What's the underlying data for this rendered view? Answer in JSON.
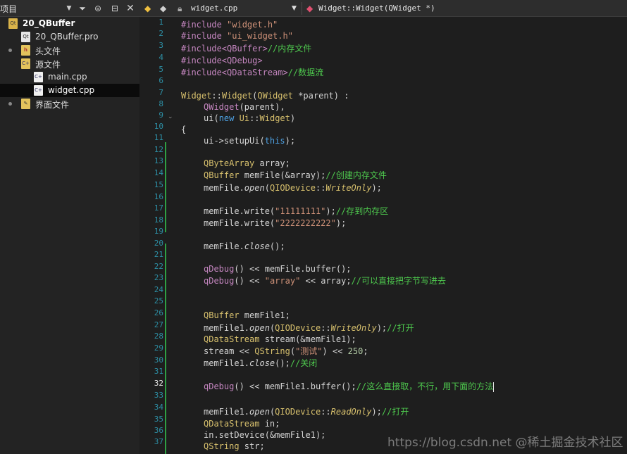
{
  "left_panel": {
    "title": "项目",
    "tree": [
      {
        "label": "20_QBuffer",
        "kind": "project",
        "bold": true
      },
      {
        "label": "20_QBuffer.pro",
        "kind": "pro"
      },
      {
        "label": "头文件",
        "kind": "folder-h"
      },
      {
        "label": "源文件",
        "kind": "folder-cpp"
      },
      {
        "label": "main.cpp",
        "kind": "cpp"
      },
      {
        "label": "widget.cpp",
        "kind": "cpp",
        "selected": true
      },
      {
        "label": "界面文件",
        "kind": "folder-ui"
      }
    ]
  },
  "editor": {
    "file_name": "widget.cpp",
    "symbol": "Widget::Widget(QWidget *)",
    "current_line": 32,
    "line_numbers": [
      1,
      2,
      3,
      4,
      5,
      6,
      7,
      8,
      9,
      10,
      11,
      12,
      13,
      14,
      15,
      16,
      17,
      18,
      19,
      20,
      21,
      22,
      23,
      24,
      25,
      26,
      27,
      28,
      29,
      30,
      31,
      32,
      33,
      34,
      35,
      36,
      37
    ]
  },
  "code_text": {
    "l1_a": "#include",
    "l1_b": "\"widget.h\"",
    "l2_a": "#include",
    "l2_b": "\"ui_widget.h\"",
    "l3_a": "#include<QBuffer>",
    "l3_b": "//内存文件",
    "l4_a": "#include<QDebug>",
    "l5_a": "#include<QDataStream>",
    "l5_b": "//数据流",
    "l7_a": "Widget",
    "l7_b": "::",
    "l7_c": "Widget",
    "l7_d": "(",
    "l7_e": "QWidget",
    "l7_f": " *parent) :",
    "l8_a": "QWidget",
    "l8_b": "(parent),",
    "l9_a": "ui(",
    "l9_b": "new",
    "l9_c": " ",
    "l9_d": "Ui",
    "l9_e": "::",
    "l9_f": "Widget",
    "l9_g": ")",
    "l10_a": "{",
    "l11_a": "ui->setupUi(",
    "l11_b": "this",
    "l11_c": ");",
    "l13_a": "QByteArray",
    "l13_b": " array;",
    "l14_a": "QBuffer",
    "l14_b": " memFile(&array);",
    "l14_c": "//创建内存文件",
    "l15_a": "memFile.",
    "l15_b": "open",
    "l15_c": "(",
    "l15_d": "QIODevice",
    "l15_e": "::",
    "l15_f": "WriteOnly",
    "l15_g": ");",
    "l17_a": "memFile.write(",
    "l17_b": "\"11111111\"",
    "l17_c": ");",
    "l17_d": "//存到内存区",
    "l18_a": "memFile.write(",
    "l18_b": "\"2222222222\"",
    "l18_c": ");",
    "l20_a": "memFile.",
    "l20_b": "close",
    "l20_c": "();",
    "l22_a": "qDebug",
    "l22_b": "() << memFile.buffer();",
    "l23_a": "qDebug",
    "l23_b": "() << ",
    "l23_c": "\"array\"",
    "l23_d": " << array;",
    "l23_e": "//可以直接把字节写进去",
    "l26_a": "QBuffer",
    "l26_b": " memFile1;",
    "l27_a": "memFile1.",
    "l27_b": "open",
    "l27_c": "(",
    "l27_d": "QIODevice",
    "l27_e": "::",
    "l27_f": "WriteOnly",
    "l27_g": ");",
    "l27_h": "//打开",
    "l28_a": "QDataStream",
    "l28_b": " stream(&memFile1);",
    "l29_a": "stream << ",
    "l29_b": "QString",
    "l29_c": "(",
    "l29_d": "\"测试\"",
    "l29_e": ") << ",
    "l29_f": "250",
    "l29_g": ";",
    "l30_a": "memFile1.",
    "l30_b": "close",
    "l30_c": "();",
    "l30_d": "//关闭",
    "l32_a": "qDebug",
    "l32_b": "() << memFile1.buffer();",
    "l32_c": "//这么直接取，不行，用下面的方法",
    "l34_a": "memFile1.",
    "l34_b": "open",
    "l34_c": "(",
    "l34_d": "QIODevice",
    "l34_e": "::",
    "l34_f": "ReadOnly",
    "l34_g": ");",
    "l34_h": "//打开",
    "l35_a": "QDataStream",
    "l35_b": " in;",
    "l36_a": "in.setDevice(&memFile1);",
    "l37_a": "QString",
    "l37_b": " str;"
  },
  "watermark": "https://blog.csdn.net @稀土掘金技术社区",
  "colors": {
    "preprocessor": "#c586c0",
    "string": "#ce9178",
    "comment": "#4ec94e",
    "type": "#d7c06d",
    "keyword": "#4fa3e6",
    "line_number": "#2d8fa5"
  }
}
